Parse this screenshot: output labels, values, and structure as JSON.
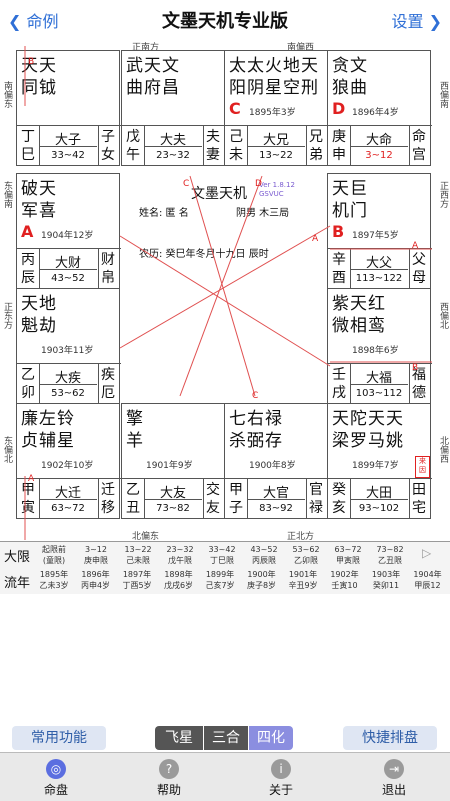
{
  "header": {
    "back_label": "命例",
    "title": "文墨天机专业版",
    "settings_label": "设置"
  },
  "board": {
    "top_labels": [
      "正南方",
      "南偏西"
    ],
    "bottom_labels": [
      "北偏东",
      "正北方"
    ],
    "left_labels": [
      "南偏东",
      "东偏南",
      "正东方",
      "东偏北"
    ],
    "right_labels": [
      "西偏南",
      "正西方",
      "西偏北",
      "北偏西"
    ],
    "center": {
      "title": "文墨天机",
      "version": "Ver 1.8.12",
      "version2": "GSVUC",
      "name_line": "姓名: 匿 名",
      "gender_line": "阴男 木三局",
      "lunar_line": "农历: 癸巳年冬月十九日 辰时"
    },
    "palaces": [
      {
        "stars": "天天\n同钺",
        "letter": "",
        "age": "",
        "gz": "丁巳",
        "limit": "33~42",
        "palace": "子女",
        "tag": "大子",
        "lim_red": false
      },
      {
        "stars": "武天文\n曲府昌",
        "letter": "",
        "age": "",
        "gz": "戊午",
        "limit": "23~32",
        "palace": "夫妻",
        "tag": "大夫",
        "lim_red": false
      },
      {
        "stars": "太太火地天\n阳阴星空刑",
        "letter": "C",
        "age": "1895年3岁",
        "gz": "己未",
        "limit": "13~22",
        "palace": "兄弟",
        "tag": "大兄",
        "lim_red": false
      },
      {
        "stars": "贪文\n狼曲",
        "letter": "D",
        "age": "1896年4岁",
        "gz": "庚申",
        "limit": "3~12",
        "palace": "命宫",
        "tag": "大命",
        "lim_red": true
      },
      {
        "stars": "破天\n军喜",
        "letter": "A",
        "age": "1904年12岁",
        "gz": "丙辰",
        "limit": "43~52",
        "palace": "财帛",
        "tag": "大财",
        "lim_red": false
      },
      {
        "stars": "天巨\n机门",
        "letter": "B",
        "age": "1897年5岁",
        "gz": "辛酉",
        "limit": "113~122",
        "palace": "父母",
        "tag": "大父",
        "lim_red": false
      },
      {
        "stars": "天地\n魁劫",
        "letter": "",
        "age": "1903年11岁",
        "gz": "乙卯",
        "limit": "53~62",
        "palace": "疾厄",
        "tag": "大疾",
        "lim_red": false
      },
      {
        "stars": "紫天红\n微相鸾",
        "letter": "",
        "age": "1898年6岁",
        "gz": "壬戌",
        "limit": "103~112",
        "palace": "福德",
        "tag": "大福",
        "lim_red": false
      },
      {
        "stars": "廉左铃\n贞辅星",
        "letter": "",
        "age": "1902年10岁",
        "gz": "甲寅",
        "limit": "63~72",
        "palace": "迁移",
        "tag": "大迁",
        "lim_red": false
      },
      {
        "stars": "擎\n羊",
        "letter": "",
        "age": "1901年9岁",
        "gz": "乙丑",
        "limit": "73~82",
        "palace": "交友",
        "tag": "大友",
        "lim_red": false
      },
      {
        "stars": "七右禄\n杀弼存",
        "letter": "",
        "age": "1900年8岁",
        "gz": "甲子",
        "limit": "83~92",
        "palace": "官禄",
        "tag": "大官",
        "lim_red": false
      },
      {
        "stars": "天陀天天\n梁罗马姚",
        "letter": "",
        "age": "1899年7岁",
        "gz": "癸亥",
        "limit": "93~102",
        "palace": "田宅",
        "tag": "大田",
        "lim_red": false
      }
    ],
    "lai_yin": "来因"
  },
  "daxian": {
    "label": "大限",
    "items": [
      [
        "起限前",
        "(童限)"
      ],
      [
        "3~12",
        "庚申限"
      ],
      [
        "13~22",
        "己未限"
      ],
      [
        "23~32",
        "戊午限"
      ],
      [
        "33~42",
        "丁巳限"
      ],
      [
        "43~52",
        "丙辰限"
      ],
      [
        "53~62",
        "乙卯限"
      ],
      [
        "63~72",
        "甲寅限"
      ],
      [
        "73~82",
        "乙丑限"
      ]
    ]
  },
  "liunian": {
    "label": "流年",
    "items": [
      [
        "1895年",
        "乙未3岁"
      ],
      [
        "1896年",
        "丙申4岁"
      ],
      [
        "1897年",
        "丁酉5岁"
      ],
      [
        "1898年",
        "戊戌6岁"
      ],
      [
        "1899年",
        "己亥7岁"
      ],
      [
        "1900年",
        "庚子8岁"
      ],
      [
        "1901年",
        "辛丑9岁"
      ],
      [
        "1902年",
        "壬寅10"
      ],
      [
        "1903年",
        "癸卯11"
      ],
      [
        "1904年",
        "甲辰12"
      ]
    ]
  },
  "toolbar": {
    "common_label": "常用功能",
    "seg1": "飞星",
    "seg2": "三合",
    "seg3": "四化",
    "quick_label": "快捷排盘"
  },
  "tabs": [
    {
      "label": "命盘",
      "icon": "chart-icon"
    },
    {
      "label": "帮助",
      "icon": "help-icon"
    },
    {
      "label": "关于",
      "icon": "info-icon"
    },
    {
      "label": "退出",
      "icon": "exit-icon"
    }
  ]
}
